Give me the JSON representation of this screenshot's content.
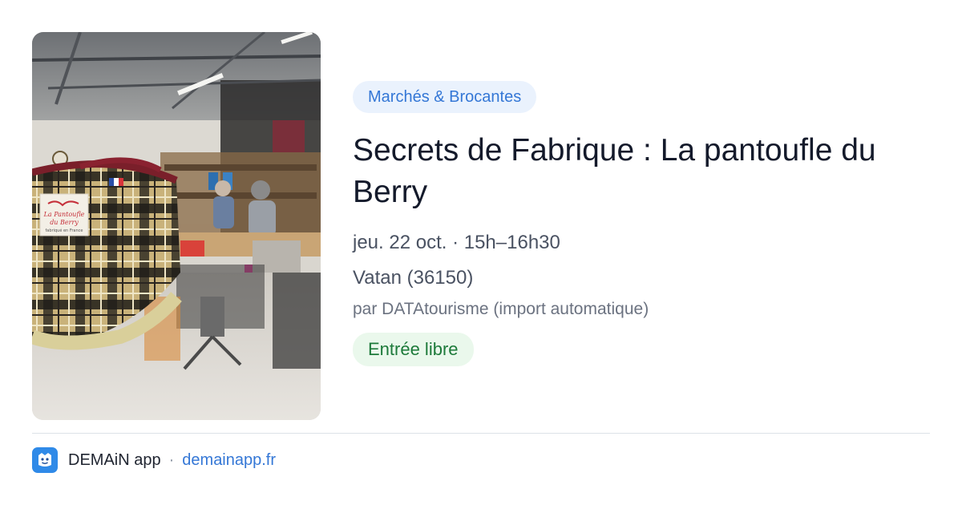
{
  "event": {
    "category": "Marchés & Brocantes",
    "title": "Secrets de Fabrique : La pantoufle du Berry",
    "when": "jeu. 22 oct. · 15h–16h30",
    "where": "Vatan (36150)",
    "source": "par DATAtourisme (import automatique)",
    "price": "Entrée libre"
  },
  "photo": {
    "label_text": "La Pantoufle du Berry",
    "label_subtext": "fabriqué en France"
  },
  "footer": {
    "app_name": "DEMAiN app",
    "separator": "·",
    "domain": "demainapp.fr"
  },
  "colors": {
    "accent_blue": "#3477d6",
    "category_bg": "#eaf2fd",
    "price_green": "#1d7a3a",
    "price_bg": "#eaf8ec",
    "title": "#141a2b",
    "app_icon_bg": "#2f8ae8"
  }
}
